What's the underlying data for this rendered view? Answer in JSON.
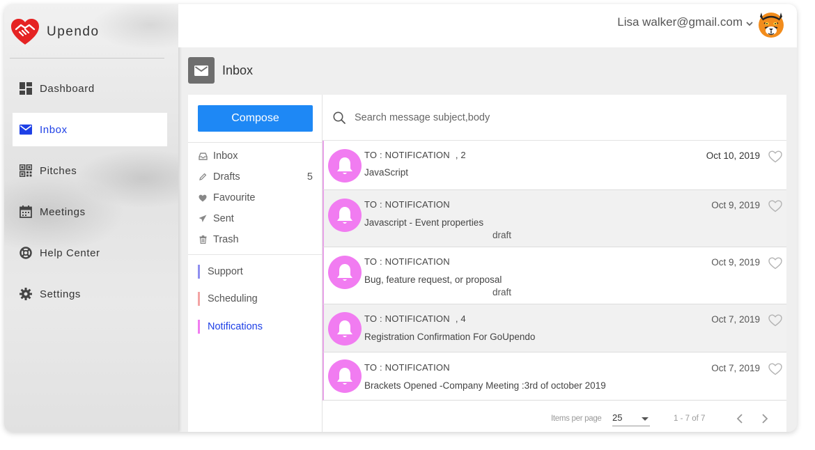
{
  "brand": {
    "name": "Upendo"
  },
  "sidebar": {
    "items": [
      {
        "label": "Dashboard",
        "icon": "dashboard-icon"
      },
      {
        "label": "Inbox",
        "icon": "mail-icon",
        "active": true
      },
      {
        "label": "Pitches",
        "icon": "pitches-icon"
      },
      {
        "label": "Meetings",
        "icon": "calendar-icon"
      },
      {
        "label": "Help Center",
        "icon": "lifebuoy-icon"
      },
      {
        "label": "Settings",
        "icon": "gear-icon"
      }
    ]
  },
  "header": {
    "user_email": "Lisa walker@gmail.com"
  },
  "page": {
    "title": "Inbox"
  },
  "folders": {
    "compose_label": "Compose",
    "items": [
      {
        "label": "Inbox",
        "icon": "inbox-icon"
      },
      {
        "label": "Drafts",
        "icon": "pencil-icon",
        "count": "5"
      },
      {
        "label": "Favourite",
        "icon": "heart-icon"
      },
      {
        "label": "Sent",
        "icon": "send-icon"
      },
      {
        "label": "Trash",
        "icon": "trash-icon"
      }
    ],
    "labels": [
      {
        "label": "Support",
        "color": "#8f8ff0"
      },
      {
        "label": "Scheduling",
        "color": "#f3a4a4"
      },
      {
        "label": "Notifications",
        "color": "#f17cf1",
        "active": true
      }
    ]
  },
  "search": {
    "placeholder": "Search message subject,body"
  },
  "messages": [
    {
      "to": "TO : NOTIFICATION",
      "count": ", 2",
      "subject": "JavaScript",
      "draft": "",
      "date": "Oct 10, 2019",
      "unread": true
    },
    {
      "to": "TO : NOTIFICATION",
      "count": "",
      "subject": "Javascript - Event properties",
      "draft": "draft",
      "date": "Oct 9, 2019",
      "unread": false
    },
    {
      "to": "TO : NOTIFICATION",
      "count": "",
      "subject": "Bug, feature request, or proposal",
      "draft": "draft",
      "date": "Oct 9, 2019",
      "unread": false
    },
    {
      "to": "TO : NOTIFICATION",
      "count": ", 4",
      "subject": "Registration Confirmation For GoUpendo",
      "draft": "",
      "date": "Oct 7, 2019",
      "unread": false
    },
    {
      "to": "TO : NOTIFICATION",
      "count": "",
      "subject": "Brackets Opened -Company Meeting :3rd of october 2019",
      "draft": "",
      "date": "Oct 7, 2019",
      "unread": false
    }
  ],
  "pager": {
    "items_per_page_label": "Items per page",
    "items_per_page": "25",
    "range": "1 - 7 of 7"
  },
  "colors": {
    "accent": "#1e40e6",
    "compose": "#1e88f5",
    "notification": "#f17cf1"
  }
}
